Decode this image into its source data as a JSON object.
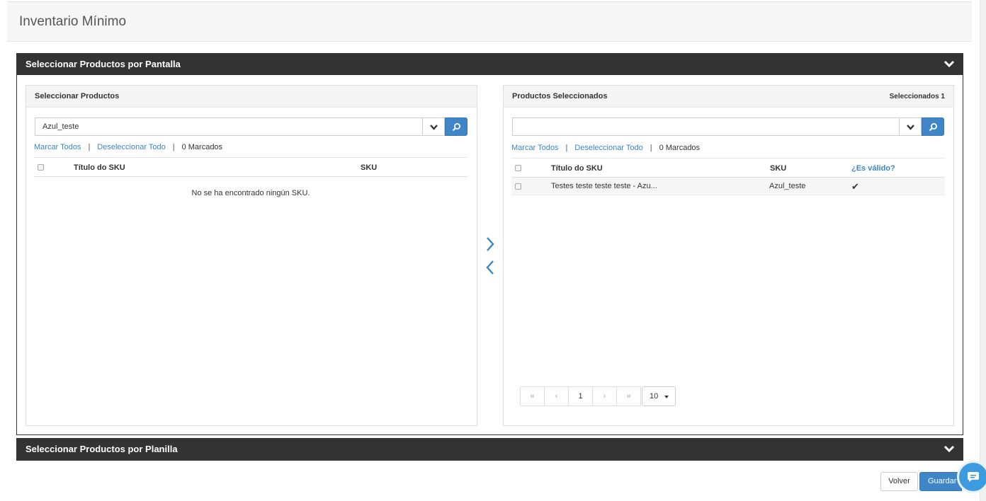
{
  "page": {
    "title": "Inventario Mínimo"
  },
  "section_screen": {
    "title": "Seleccionar Productos por Pantalla"
  },
  "section_sheet": {
    "title": "Seleccionar Productos por Planilla"
  },
  "left_panel": {
    "title": "Seleccionar Productos",
    "search_value": "Azul_teste",
    "mark_all": "Marcar Todos",
    "deselect_all": "Deseleccionar Todo",
    "separator": "|",
    "marked": "0 Marcados",
    "columns": {
      "title": "Título do SKU",
      "sku": "SKU"
    },
    "empty_message": "No se ha encontrado ningún SKU."
  },
  "right_panel": {
    "title": "Productos Seleccionados",
    "count": "Seleccionados 1",
    "search_value": "",
    "mark_all": "Marcar Todos",
    "deselect_all": "Deseleccionar Todo",
    "separator": "|",
    "marked": "0 Marcados",
    "columns": {
      "title": "Título do SKU",
      "sku": "SKU",
      "valid": "¿Es válido?"
    },
    "rows": [
      {
        "title": "Testes teste teste teste - Azu...",
        "sku": "Azul_teste",
        "valid": "✔"
      }
    ],
    "pagination": {
      "first": "«",
      "prev": "‹",
      "current": "1",
      "next": "›",
      "last": "»",
      "page_size": "10"
    }
  },
  "footer": {
    "back_label": "Volver",
    "save_label": "Guardar"
  },
  "colors": {
    "accordion_bg": "#333333",
    "primary": "#3f86c8",
    "link": "#3a87c5",
    "chat": "#3d9be0"
  },
  "icons": {
    "accordion_toggle": "chevron-down-icon",
    "search": "search-icon",
    "dropdown": "chevron-down-icon",
    "move_right": "chevron-right-icon",
    "move_left": "chevron-left-icon",
    "valid": "check-icon",
    "chat": "chat-icon"
  }
}
